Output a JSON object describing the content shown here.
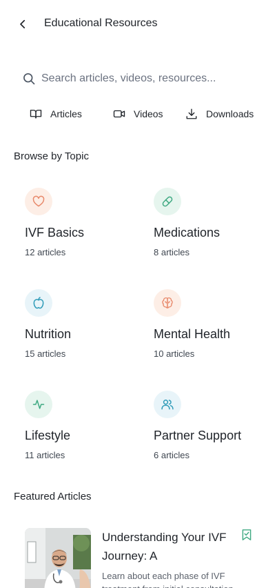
{
  "header": {
    "title": "Educational Resources"
  },
  "search": {
    "placeholder": "Search articles, videos, resources..."
  },
  "tabs": [
    {
      "label": "Articles",
      "icon": "book-open-icon"
    },
    {
      "label": "Videos",
      "icon": "video-icon"
    },
    {
      "label": "Downloads",
      "icon": "download-icon"
    }
  ],
  "browse": {
    "title": "Browse by Topic",
    "topics": [
      {
        "name": "IVF Basics",
        "count": "12 articles",
        "icon": "heart-icon",
        "tint": "#fdeee6",
        "color": "#e8896b"
      },
      {
        "name": "Medications",
        "count": "8 articles",
        "icon": "pill-icon",
        "tint": "#e6f5ee",
        "color": "#3fa982"
      },
      {
        "name": "Nutrition",
        "count": "15 articles",
        "icon": "apple-icon",
        "tint": "#e8f4f9",
        "color": "#2f9bb8"
      },
      {
        "name": "Mental Health",
        "count": "10 articles",
        "icon": "brain-icon",
        "tint": "#fdeee6",
        "color": "#e8896b"
      },
      {
        "name": "Lifestyle",
        "count": "11 articles",
        "icon": "activity-icon",
        "tint": "#e6f5ee",
        "color": "#3fa982"
      },
      {
        "name": "Partner Support",
        "count": "6 articles",
        "icon": "users-icon",
        "tint": "#e8f4f9",
        "color": "#2f9bb8"
      }
    ]
  },
  "featured": {
    "title": "Featured Articles",
    "articles": [
      {
        "title": "Understanding Your IVF Journey: A",
        "description": "Learn about each phase of IVF treatment from initial consultation",
        "bookmark_color": "#3fa982"
      }
    ]
  }
}
